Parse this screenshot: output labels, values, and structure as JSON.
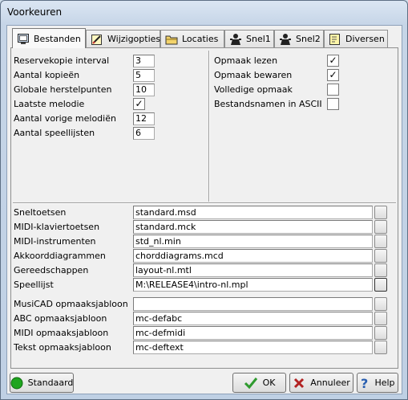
{
  "window": {
    "title": "Voorkeuren"
  },
  "tabs": [
    {
      "label": "Bestanden",
      "icon": "monitor-icon"
    },
    {
      "label": "Wijzigopties",
      "icon": "edit-options-icon"
    },
    {
      "label": "Locaties",
      "icon": "folder-icon"
    },
    {
      "label": "Snel1",
      "icon": "person-shortcut-icon"
    },
    {
      "label": "Snel2",
      "icon": "person-shortcut-icon"
    },
    {
      "label": "Diversen",
      "icon": "misc-icon"
    }
  ],
  "left_options": [
    {
      "label": "Reservekopie interval",
      "value": "3"
    },
    {
      "label": "Aantal kopieën",
      "value": "5"
    },
    {
      "label": "Globale herstelpunten",
      "value": "10"
    },
    {
      "label": "Laatste melodie",
      "checked": true
    },
    {
      "label": "Aantal vorige melodiën",
      "value": "12"
    },
    {
      "label": "Aantal speellijsten",
      "value": "6"
    }
  ],
  "right_options": [
    {
      "label": "Opmaak lezen",
      "checked": true
    },
    {
      "label": "Opmaak bewaren",
      "checked": true
    },
    {
      "label": "Volledige opmaak",
      "checked": false
    },
    {
      "label": "Bestandsnamen in ASCII",
      "checked": false
    }
  ],
  "files": [
    {
      "label": "Sneltoetsen",
      "value": "standard.msd"
    },
    {
      "label": "MIDI-klaviertoetsen",
      "value": "standard.mck"
    },
    {
      "label": "MIDI-instrumenten",
      "value": "std_nl.min"
    },
    {
      "label": "Akkoorddiagrammen",
      "value": "chorddiagrams.mcd"
    },
    {
      "label": "Gereedschappen",
      "value": "layout-nl.mtl"
    },
    {
      "label": "Speellijst",
      "value": "M:\\RELEASE4\\intro-nl.mpl"
    }
  ],
  "templates": [
    {
      "label": "MusiCAD opmaaksjabloon",
      "value": ""
    },
    {
      "label": "ABC opmaaksjabloon",
      "value": "mc-defabc"
    },
    {
      "label": "MIDI opmaaksjabloon",
      "value": "mc-defmidi"
    },
    {
      "label": "Tekst opmaaksjabloon",
      "value": "mc-deftext"
    }
  ],
  "buttons": {
    "standard": "Standaard",
    "ok": "OK",
    "cancel": "Annuleer",
    "help": "Help"
  },
  "colors": {
    "standard_dot": "#1fa51f",
    "ok_check": "#2e9a2e",
    "cancel_x": "#b22222",
    "help_q": "#2a5fb0"
  }
}
